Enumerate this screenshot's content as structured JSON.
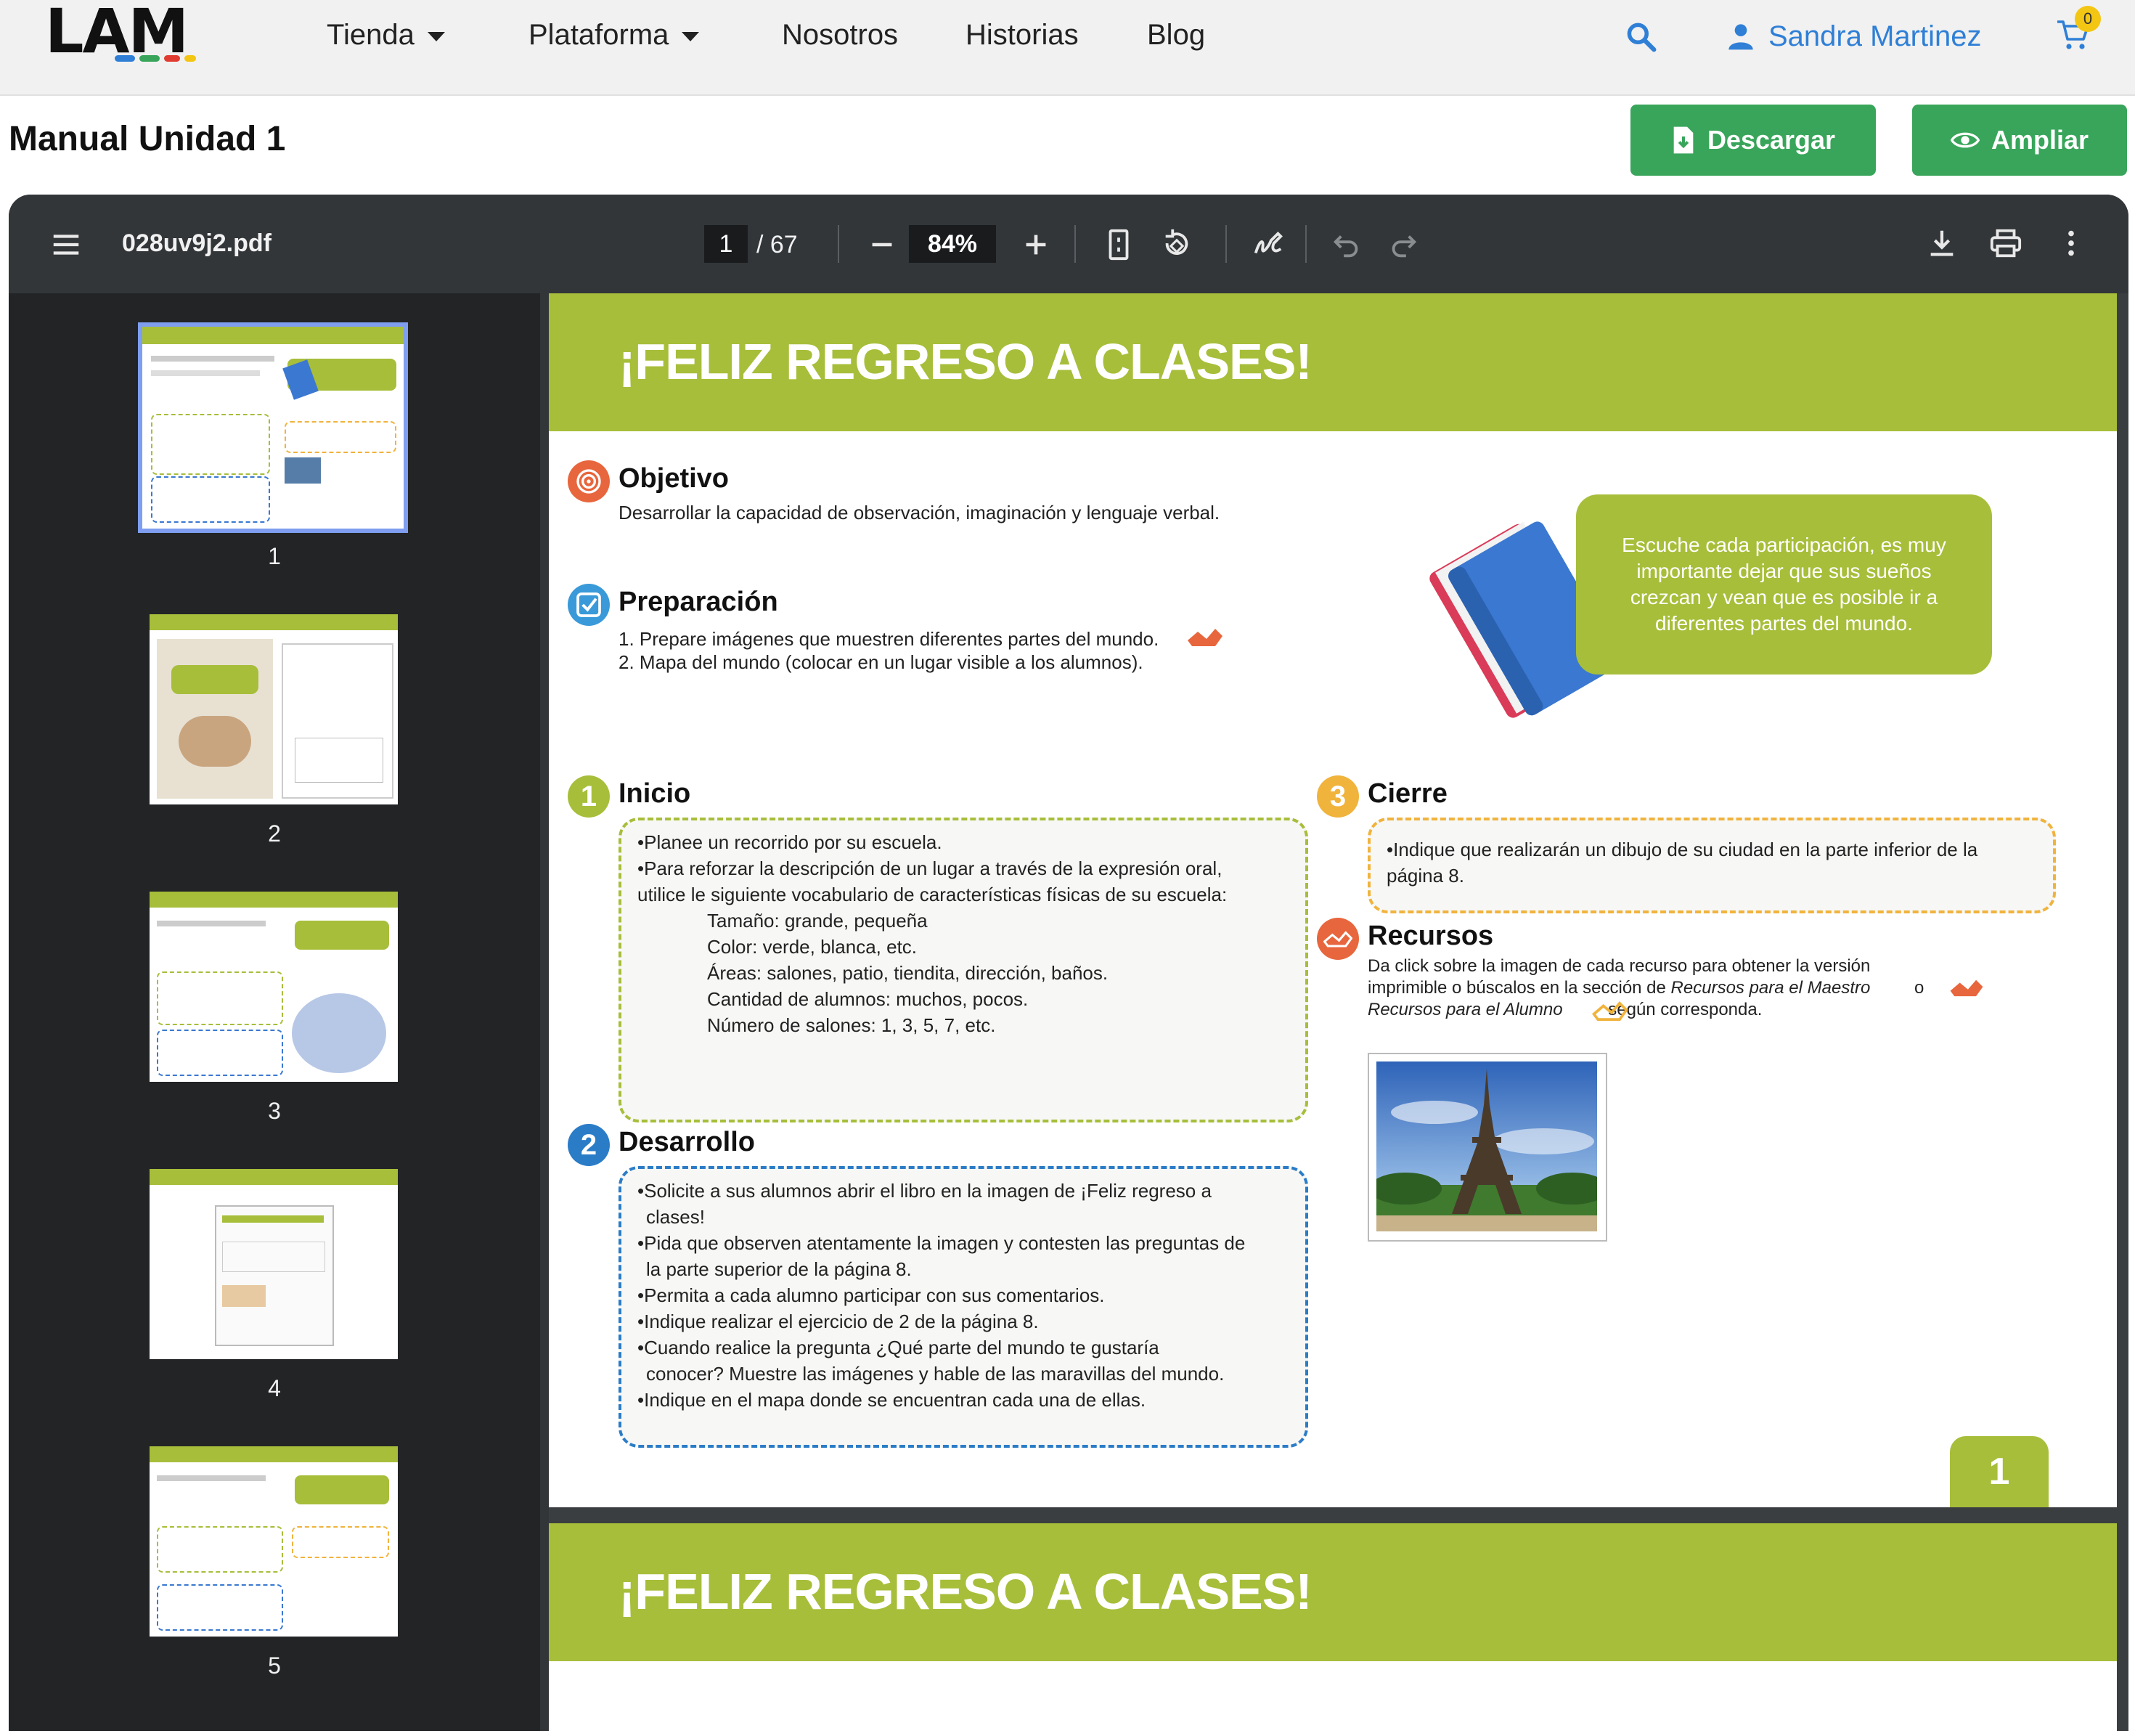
{
  "nav": {
    "logo": "LAM",
    "logo_bar_colors": [
      "#2f7fd6",
      "#38a55a",
      "#e03c31",
      "#f3c613"
    ],
    "items": [
      {
        "label": "Tienda",
        "has_dropdown": true
      },
      {
        "label": "Plataforma",
        "has_dropdown": true
      },
      {
        "label": "Nosotros",
        "has_dropdown": false
      },
      {
        "label": "Historias",
        "has_dropdown": false
      },
      {
        "label": "Blog",
        "has_dropdown": false
      }
    ],
    "user_name": "Sandra Martinez",
    "cart_count": "0",
    "icons": [
      "search-icon",
      "user-icon",
      "cart-icon"
    ]
  },
  "header": {
    "title": "Manual Unidad 1",
    "download_label": "Descargar",
    "expand_label": "Ampliar",
    "accent_color": "#38a55a"
  },
  "viewer": {
    "filename": "028uv9j2.pdf",
    "current_page": "1",
    "total_pages": "/ 67",
    "zoom": "84%",
    "thumbnails": [
      "1",
      "2",
      "3",
      "4",
      "5"
    ]
  },
  "page": {
    "banner_title": "¡FELIZ REGRESO A CLASES!",
    "brand_green": "#a7be3a",
    "objetivo": {
      "title": "Objetivo",
      "text": "Desarrollar la capacidad de observación, imaginación y lenguaje verbal."
    },
    "preparacion": {
      "title": "Preparación",
      "lines": [
        "1. Prepare imágenes que muestren diferentes partes del mundo.",
        "2. Mapa del mundo (colocar en un lugar visible a los alumnos)."
      ]
    },
    "callout": "Escuche cada participación, es muy importante dejar que sus sueños crezcan y vean que es posible ir a diferentes partes del mundo.",
    "inicio": {
      "number": "1",
      "title": "Inicio",
      "lines": [
        "•Planee un recorrido por su escuela.",
        "•Para reforzar la descripción de un lugar a través de la expresión oral,",
        "utilice le siguiente vocabulario de características físicas de su escuela:"
      ],
      "indented": [
        "Tamaño: grande, pequeña",
        "Color: verde, blanca, etc.",
        "Áreas: salones, patio, tiendita, dirección, baños.",
        "Cantidad de alumnos: muchos, pocos.",
        "Número de salones: 1, 3, 5, 7, etc."
      ]
    },
    "desarrollo": {
      "number": "2",
      "title": "Desarrollo",
      "lines": [
        "•Solicite a sus alumnos abrir el libro en la imagen de ¡Feliz regreso a",
        "clases!",
        "•Pida que observen atentamente la imagen y contesten las preguntas de",
        "la parte superior de la página 8.",
        "•Permita a cada alumno participar con sus comentarios.",
        "•Indique realizar el ejercicio de 2 de la página 8.",
        "•Cuando realice la pregunta ¿Qué parte del mundo te gustaría",
        "conocer? Muestre las imágenes y hable de las maravillas del mundo.",
        "•Indique en el mapa donde se encuentran cada una de ellas."
      ]
    },
    "cierre": {
      "number": "3",
      "title": "Cierre",
      "lines": [
        "•Indique que realizarán un dibujo de su ciudad en la parte inferior de la",
        "página 8."
      ]
    },
    "recursos": {
      "title": "Recursos",
      "line1": "Da click sobre la imagen de cada recurso para obtener la versión",
      "line2_a": "imprimible o búscalos en la sección de ",
      "line2_b": "Recursos para el Maestro",
      "line2_c": " o",
      "line3_a": "Recursos para el Alumno",
      "line3_b": " según corresponda."
    },
    "page_number": "1"
  }
}
